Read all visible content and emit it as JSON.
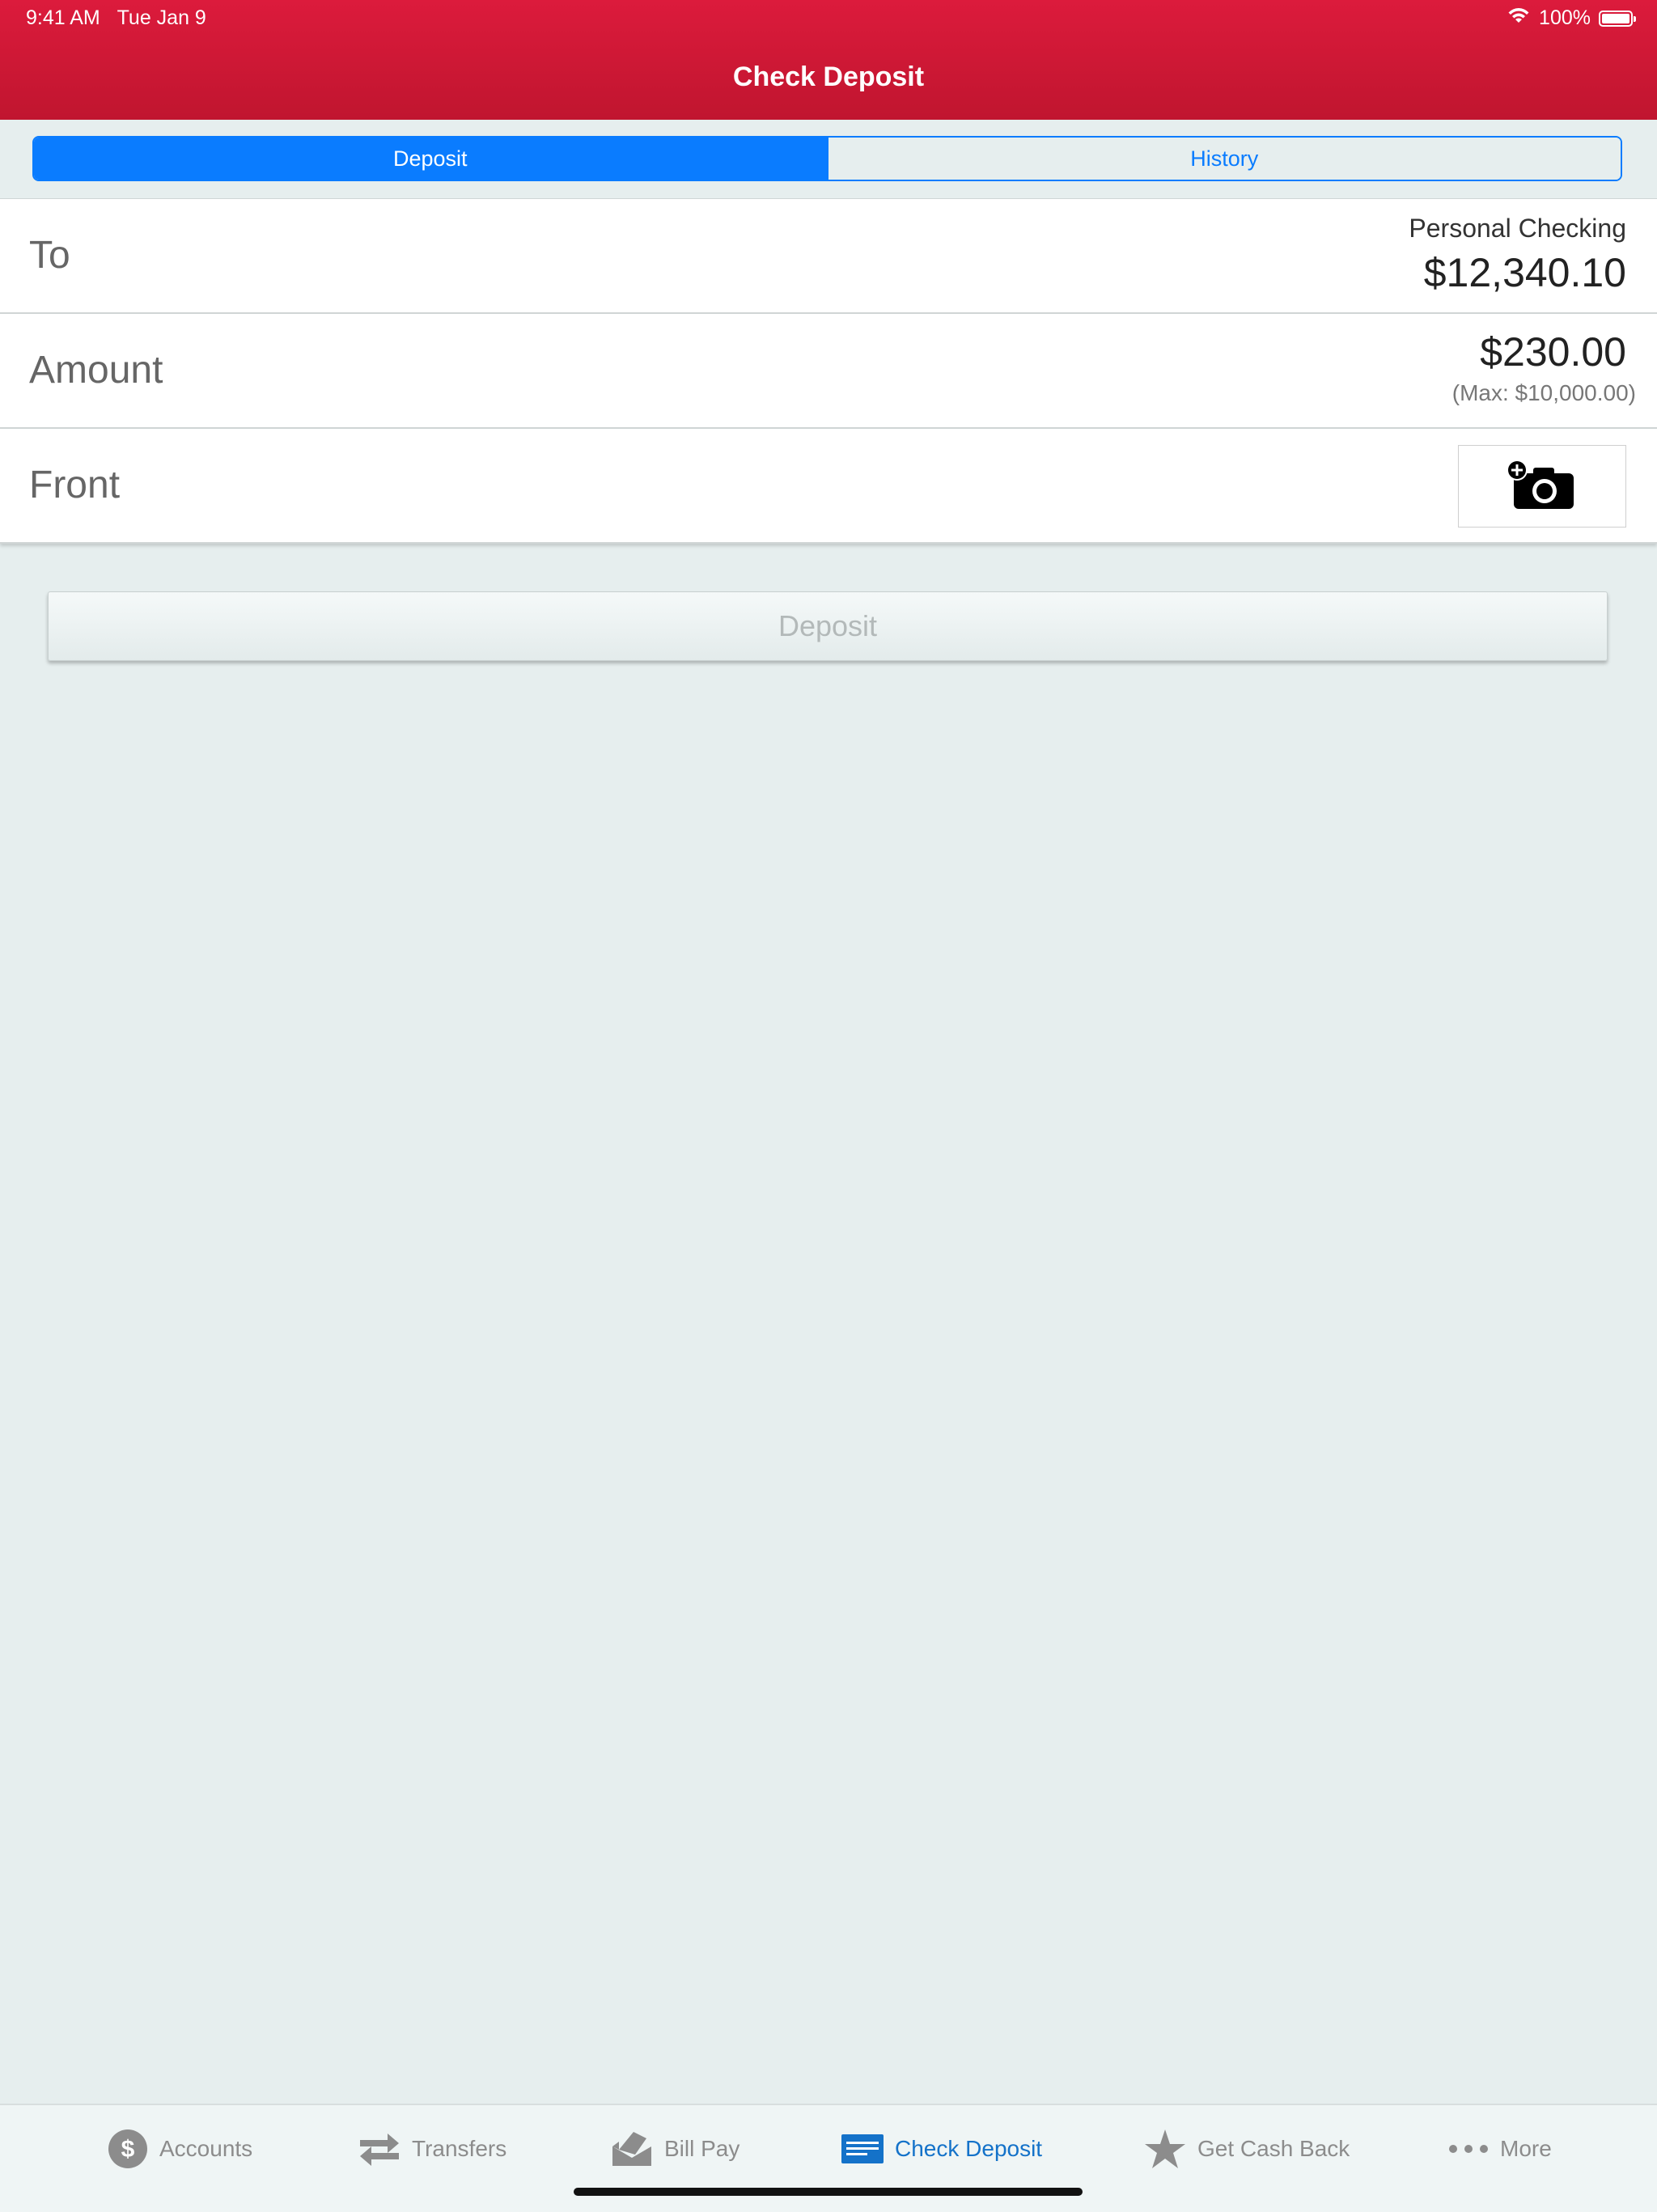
{
  "status": {
    "time": "9:41 AM",
    "date": "Tue Jan 9",
    "battery": "100%"
  },
  "header": {
    "title": "Check Deposit"
  },
  "segments": {
    "deposit": "Deposit",
    "history": "History"
  },
  "rows": {
    "to": {
      "label": "To",
      "account": "Personal Checking",
      "balance": "$12,340.10"
    },
    "amount": {
      "label": "Amount",
      "value": "$230.00",
      "max": "(Max: $10,000.00)"
    },
    "front": {
      "label": "Front"
    }
  },
  "deposit_button": {
    "label": "Deposit"
  },
  "tabs": [
    {
      "label": "Accounts",
      "icon": "dollar-circle-icon"
    },
    {
      "label": "Transfers",
      "icon": "transfer-arrows-icon"
    },
    {
      "label": "Bill Pay",
      "icon": "envelope-icon"
    },
    {
      "label": "Check Deposit",
      "icon": "check-icon"
    },
    {
      "label": "Get Cash Back",
      "icon": "star-icon"
    },
    {
      "label": "More",
      "icon": "more-dots-icon"
    }
  ],
  "colors": {
    "header": "#d41a37",
    "accent": "#0a7cff",
    "tab_active": "#1472c9",
    "tab_inactive": "#8c8c8c"
  }
}
